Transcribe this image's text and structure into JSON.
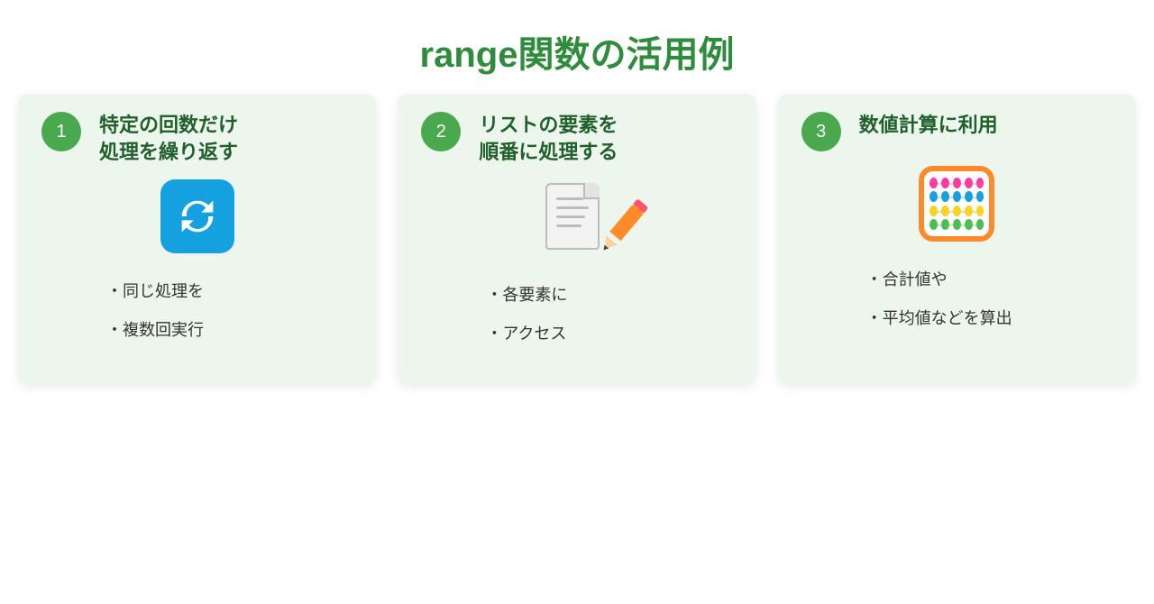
{
  "title": "range関数の活用例",
  "colors": {
    "title": "#2f8c3c",
    "cardBg": "#edf6ed",
    "badge": "#4aa94e",
    "cardTitle": "#21602d",
    "iconBlue": "#15a0e0",
    "iconOrange": "#ff8a29"
  },
  "cards": [
    {
      "number": "1",
      "titleLine1": "特定の回数だけ",
      "titleLine2": "処理を繰り返す",
      "icon": "refresh-icon",
      "bullets": [
        "・同じ処理を",
        "・複数回実行"
      ]
    },
    {
      "number": "2",
      "titleLine1": "リストの要素を",
      "titleLine2": "順番に処理する",
      "icon": "note-pencil-icon",
      "bullets": [
        "・各要素に",
        "・アクセス"
      ]
    },
    {
      "number": "3",
      "titleLine1": "数値計算に利用",
      "titleLine2": "",
      "icon": "abacus-icon",
      "bullets": [
        "・合計値や",
        "・平均値などを算出"
      ]
    }
  ],
  "abacusBeads": [
    [
      "#ff3aa2",
      "#ff3aa2",
      "#ff3aa2",
      "#ff3aa2",
      "#ff3aa2"
    ],
    [
      "#17a0e0",
      "#17a0e0",
      "#17a0e0",
      "#17a0e0",
      "#17a0e0"
    ],
    [
      "#ffd21f",
      "#ffd21f",
      "#ffd21f",
      "#ffd21f",
      "#ffd21f"
    ],
    [
      "#4bbf4f",
      "#4bbf4f",
      "#4bbf4f",
      "#4bbf4f",
      "#4bbf4f"
    ]
  ]
}
